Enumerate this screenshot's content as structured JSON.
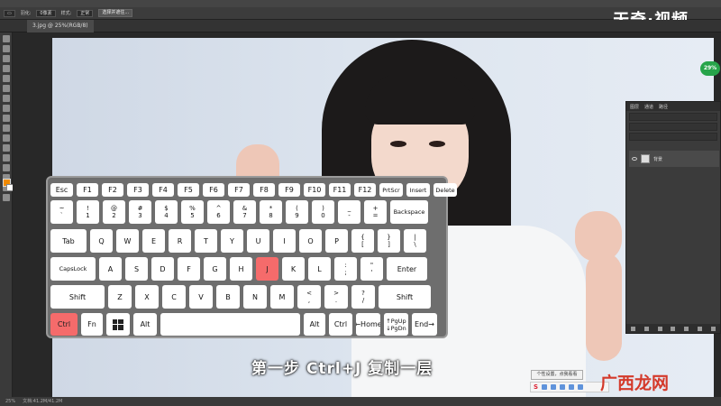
{
  "window": {
    "brand": "天奇·视频",
    "tab_title": "3.jpg @ 25%(RGB/8)",
    "zoom_badge": "29%"
  },
  "options_bar": {
    "feather_label": "羽化:",
    "feather_value": "0像素",
    "style_label": "样式:",
    "style_value": "正常",
    "select_button": "选择并遮住..."
  },
  "layers_panel": {
    "tabs": [
      "图层",
      "通道",
      "路径"
    ],
    "layer_name": "背景"
  },
  "statusbar": {
    "zoom": "25%",
    "doc": "文档:41.2M/41.2M"
  },
  "keyboard": {
    "highlight_keys": [
      "Ctrl",
      "J"
    ],
    "rows": [
      [
        {
          "l": "Esc"
        },
        {
          "l": "F1"
        },
        {
          "l": "F2"
        },
        {
          "l": "F3"
        },
        {
          "l": "F4"
        },
        {
          "l": "F5"
        },
        {
          "l": "F6"
        },
        {
          "l": "F7"
        },
        {
          "l": "F8"
        },
        {
          "l": "F9"
        },
        {
          "l": "F10"
        },
        {
          "l": "F11"
        },
        {
          "l": "F12"
        },
        {
          "l": "PrtScr"
        },
        {
          "l": "Insert"
        },
        {
          "l": "Delete"
        }
      ],
      [
        {
          "t": "~",
          "b": "`"
        },
        {
          "t": "!",
          "b": "1"
        },
        {
          "t": "@",
          "b": "2"
        },
        {
          "t": "#",
          "b": "3"
        },
        {
          "t": "$",
          "b": "4"
        },
        {
          "t": "%",
          "b": "5"
        },
        {
          "t": "^",
          "b": "6"
        },
        {
          "t": "&",
          "b": "7"
        },
        {
          "t": "*",
          "b": "8"
        },
        {
          "t": "(",
          "b": "9"
        },
        {
          "t": ")",
          "b": "0"
        },
        {
          "t": "_",
          "b": "-"
        },
        {
          "t": "+",
          "b": "="
        },
        {
          "l": "Backspace"
        }
      ],
      [
        {
          "l": "Tab"
        },
        {
          "l": "Q"
        },
        {
          "l": "W"
        },
        {
          "l": "E"
        },
        {
          "l": "R"
        },
        {
          "l": "T"
        },
        {
          "l": "Y"
        },
        {
          "l": "U"
        },
        {
          "l": "I"
        },
        {
          "l": "O"
        },
        {
          "l": "P"
        },
        {
          "t": "{",
          "b": "["
        },
        {
          "t": "}",
          "b": "]"
        },
        {
          "t": "|",
          "b": "\\"
        }
      ],
      [
        {
          "l": "CapsLock"
        },
        {
          "l": "A"
        },
        {
          "l": "S"
        },
        {
          "l": "D"
        },
        {
          "l": "F"
        },
        {
          "l": "G"
        },
        {
          "l": "H"
        },
        {
          "l": "J"
        },
        {
          "l": "K"
        },
        {
          "l": "L"
        },
        {
          "t": ":",
          "b": ";"
        },
        {
          "t": "\"",
          "b": "'"
        },
        {
          "l": "Enter"
        }
      ],
      [
        {
          "l": "Shift"
        },
        {
          "l": "Z"
        },
        {
          "l": "X"
        },
        {
          "l": "C"
        },
        {
          "l": "V"
        },
        {
          "l": "B"
        },
        {
          "l": "N"
        },
        {
          "l": "M"
        },
        {
          "t": "<",
          "b": ","
        },
        {
          "t": ">",
          "b": "."
        },
        {
          "t": "?",
          "b": "/"
        },
        {
          "l": "Shift"
        }
      ],
      [
        {
          "l": "Ctrl"
        },
        {
          "l": "Fn"
        },
        {
          "l": "win-icon"
        },
        {
          "l": "Alt"
        },
        {
          "l": ""
        },
        {
          "l": "Alt"
        },
        {
          "l": "Ctrl"
        },
        {
          "l": "←Home"
        },
        {
          "t": "↑PgUp",
          "b": "↓PgDn"
        },
        {
          "l": "End→"
        }
      ]
    ]
  },
  "subtitle": "第一步 Ctrl+J 复制一层",
  "tray": {
    "tooltip": "个性设置，点我看看",
    "logo": "S"
  },
  "watermark": "广西龙网"
}
